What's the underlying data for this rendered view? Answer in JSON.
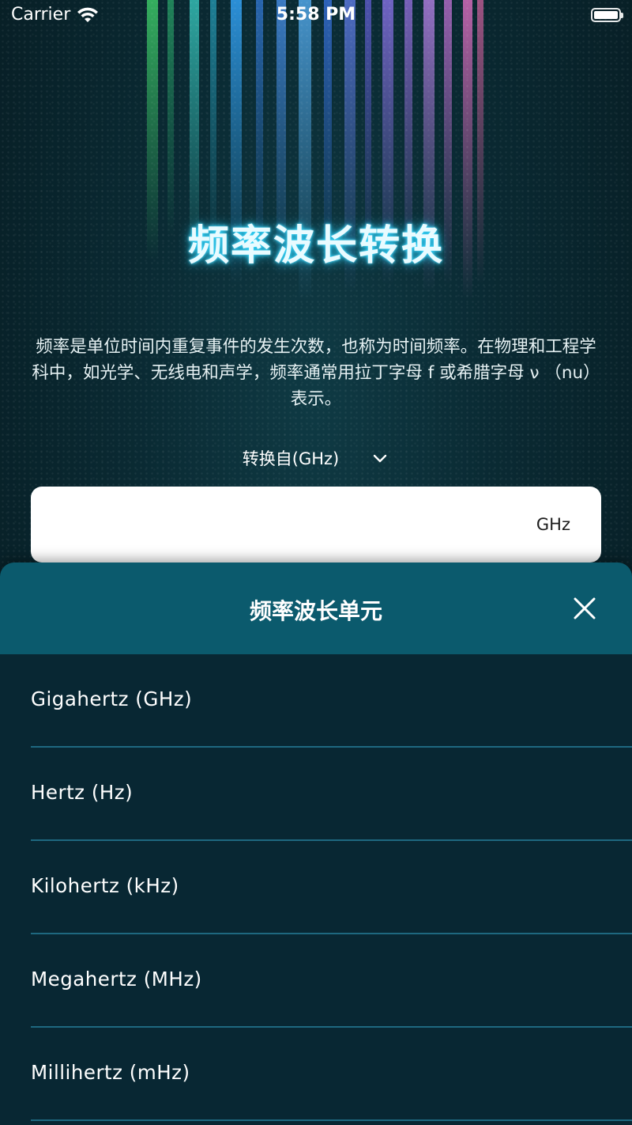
{
  "status_bar": {
    "carrier": "Carrier",
    "time": "5:58 PM"
  },
  "hero": {
    "title": "频率波长转换",
    "description": "频率是单位时间内重复事件的发生次数，也称为时间频率。在物理和工程学科中，如光学、无线电和声学，频率通常用拉丁字母 f 或希腊字母 ν （nu） 表示。"
  },
  "converter": {
    "from_label": "转换自(GHz)",
    "input_value": "",
    "unit_suffix": "GHz"
  },
  "sheet": {
    "title": "频率波长单元",
    "units": [
      {
        "label": "Gigahertz (GHz)"
      },
      {
        "label": "Hertz (Hz)"
      },
      {
        "label": "Kilohertz (kHz)"
      },
      {
        "label": "Megahertz (MHz)"
      },
      {
        "label": "Millihertz (mHz)"
      }
    ]
  },
  "icons": {
    "wifi": "wifi-icon",
    "battery": "battery-icon",
    "dropdown": "chevron-down-icon",
    "close": "close-icon"
  },
  "colors": {
    "background": "#061a20",
    "sheet_background": "#082733",
    "sheet_header": "#0b5a6d",
    "divider": "#1e6880",
    "title_glow": "#35d8ff"
  }
}
